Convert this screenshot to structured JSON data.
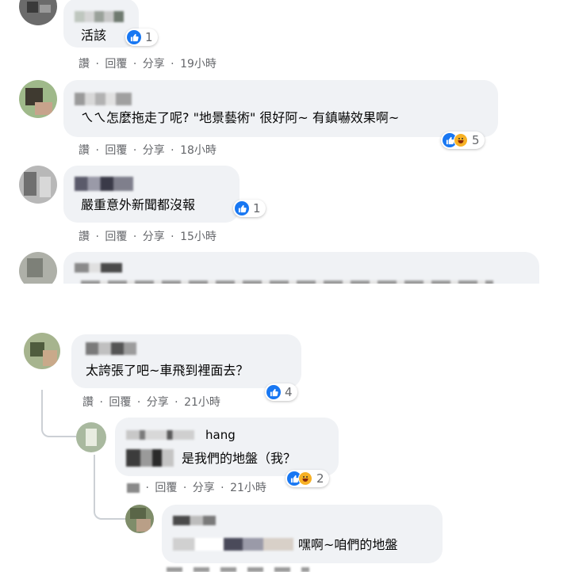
{
  "actions": {
    "like": "讚",
    "reply": "回覆",
    "share": "分享",
    "sep": "·"
  },
  "comments": [
    {
      "text": "活該",
      "reaction_count": "1",
      "time": "19小時"
    },
    {
      "text": "ㄟㄟ怎麼拖走了呢? \"地景藝術\" 很好阿~ 有鎮嚇效果啊~",
      "reaction_count": "5",
      "time": "18小時"
    },
    {
      "text": "嚴重意外新聞都沒報",
      "reaction_count": "1",
      "time": "15小時"
    },
    {
      "text": "太誇張了吧~車飛到裡面去？",
      "reaction_count": "4",
      "time": "21小時"
    }
  ],
  "replies": [
    {
      "name_fragment": "hang",
      "text": "是我們的地盤（我？",
      "reaction_count": "2",
      "time": "21小時"
    },
    {
      "text": "嘿啊~咱們的地盤"
    }
  ],
  "colors": {
    "like": "#1877f2",
    "haha": "#f7b125",
    "bubble": "#f0f2f5",
    "meta": "#65676b"
  },
  "icons": [
    "like-icon",
    "haha-icon"
  ]
}
